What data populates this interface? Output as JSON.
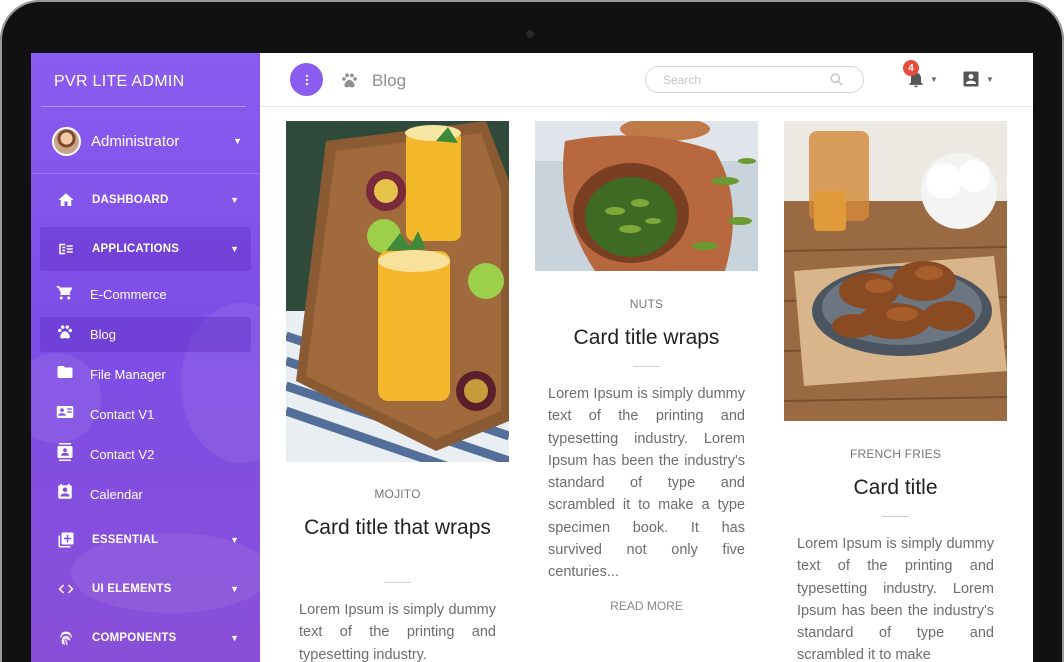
{
  "brand": {
    "title": "PVR  LITE ADMIN"
  },
  "user": {
    "name": "Administrator",
    "avatar_icon": "user-photo"
  },
  "sidebar": {
    "items": [
      {
        "label": "DASHBOARD",
        "icon": "home-icon",
        "has_caret": true
      },
      {
        "label": "APPLICATIONS",
        "icon": "apps-icon",
        "has_caret": true,
        "active": true
      },
      {
        "label": "ESSENTIAL",
        "icon": "add-box-icon",
        "has_caret": true
      },
      {
        "label": "UI ELEMENTS",
        "icon": "code-icon",
        "has_caret": true
      },
      {
        "label": "COMPONENTS",
        "icon": "fingerprint-icon",
        "has_caret": true
      }
    ],
    "sub_items": [
      {
        "label": "E-Commerce",
        "icon": "cart-icon"
      },
      {
        "label": "Blog",
        "icon": "paw-icon",
        "active": true
      },
      {
        "label": "File Manager",
        "icon": "folder-icon"
      },
      {
        "label": "Contact V1",
        "icon": "contact-card-icon"
      },
      {
        "label": "Contact V2",
        "icon": "contact-book-icon"
      },
      {
        "label": "Calendar",
        "icon": "calendar-icon"
      }
    ]
  },
  "topbar": {
    "page_title": "Blog",
    "search_placeholder": "Search",
    "notifications_count": "4"
  },
  "cards": [
    {
      "category": "MOJITO",
      "title": "Card title that wraps",
      "body": "Lorem Ipsum is simply dummy text of the printing and typesetting industry.",
      "read_more": ""
    },
    {
      "category": "NUTS",
      "title": "Card title wraps",
      "body": "Lorem Ipsum is simply dummy text of the printing and typesetting industry. Lorem Ipsum has been the industry's standard of type and scrambled it to make a type specimen book. It has survived not only five centuries...",
      "read_more": "READ MORE"
    },
    {
      "category": "FRENCH FRIES",
      "title": "Card title",
      "body": "Lorem Ipsum is simply dummy text of the printing and typesetting industry. Lorem Ipsum has been the industry's standard of type and scrambled it to make",
      "read_more": ""
    }
  ],
  "colors": {
    "accent": "#8a5cf0",
    "sidebar_top": "#8b5cf0",
    "badge": "#e74c3c"
  }
}
